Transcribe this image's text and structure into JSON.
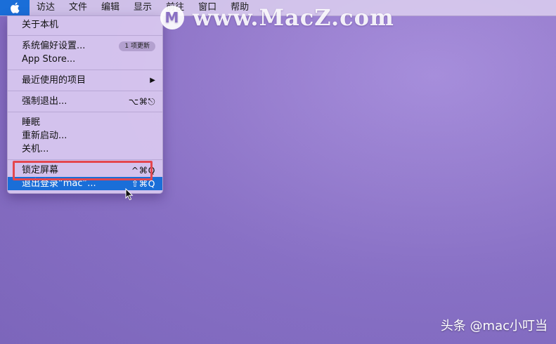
{
  "menubar": {
    "apple_icon": "apple-icon",
    "items": [
      "访达",
      "文件",
      "编辑",
      "显示",
      "前往",
      "窗口",
      "帮助"
    ]
  },
  "apple_menu": {
    "about": "关于本机",
    "system_prefs": "系统偏好设置...",
    "system_prefs_badge": "1 项更新",
    "app_store": "App Store...",
    "recent_items": "最近使用的项目",
    "force_quit": "强制退出...",
    "force_quit_shortcut": "⌥⌘⎋",
    "sleep": "睡眠",
    "restart": "重新启动...",
    "shutdown": "关机...",
    "lock_screen": "锁定屏幕",
    "lock_screen_shortcut": "^⌘Q",
    "logout": "退出登录“mac”...",
    "logout_shortcut": "⇧⌘Q"
  },
  "watermark": {
    "text": "www.MacZ.com",
    "logo_letter": "M"
  },
  "credit": "头条 @mac小叮当",
  "colors": {
    "accent": "#1a6ed8",
    "highlight_box": "#e4474f"
  }
}
